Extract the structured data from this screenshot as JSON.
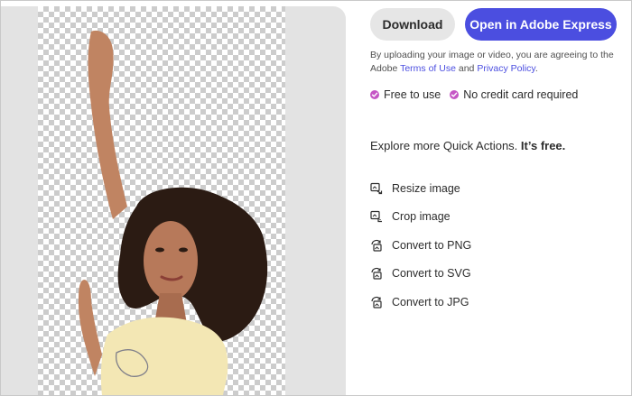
{
  "toolbar": {
    "download_label": "Download",
    "open_express_label": "Open in Adobe Express"
  },
  "consent": {
    "text_before": "By uploading your image or video, you are agreeing to the Adobe ",
    "terms_link": "Terms of Use",
    "text_and": " and ",
    "privacy_link": "Privacy Policy",
    "text_end": "."
  },
  "perks": [
    {
      "label": "Free to use",
      "icon": "check-circle-icon"
    },
    {
      "label": "No credit card required",
      "icon": "check-circle-icon"
    }
  ],
  "explore": {
    "lead": "Explore more Quick Actions. ",
    "emphasis": "It’s free."
  },
  "quick_actions": [
    {
      "label": "Resize image",
      "icon": "resize-image-icon"
    },
    {
      "label": "Crop image",
      "icon": "crop-image-icon"
    },
    {
      "label": "Convert to PNG",
      "icon": "convert-image-icon"
    },
    {
      "label": "Convert to SVG",
      "icon": "convert-image-icon"
    },
    {
      "label": "Convert to JPG",
      "icon": "convert-image-icon"
    }
  ],
  "colors": {
    "accent": "#4b4ee0",
    "perk_check": "#c556c5",
    "secondary_button": "#e6e6e6",
    "panel_bg": "#e3e3e3"
  }
}
